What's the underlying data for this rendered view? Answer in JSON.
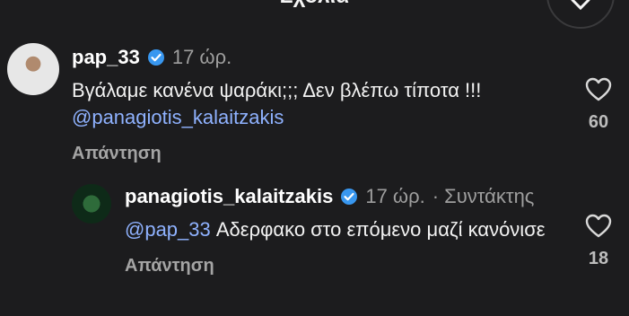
{
  "header": {
    "title": "Σχόλια"
  },
  "comments": [
    {
      "username": "pap_33",
      "time": "17 ώρ.",
      "author_tag": "",
      "text_before": "Βγάλαμε κανένα ψαράκι;;; Δεν βλέπω τίποτα !!! ",
      "mention": "@panagiotis_kalaitzakis",
      "text_after": "",
      "reply_label": "Απάντηση",
      "likes": "60"
    },
    {
      "username": "panagiotis_kalaitzakis",
      "time": "17 ώρ.",
      "author_tag": "· Συντάκτης",
      "text_before": "",
      "mention": "@pap_33",
      "text_after": " Αδερφακο στο επόμενο μαζί κανόνισε",
      "reply_label": "Απάντηση",
      "likes": "18"
    }
  ],
  "colors": {
    "background": "#1c1c1e",
    "mention": "#8fb2ff",
    "verified": "#3897f0"
  },
  "icons": {
    "verified": "verified-badge-icon",
    "like": "heart-icon"
  }
}
